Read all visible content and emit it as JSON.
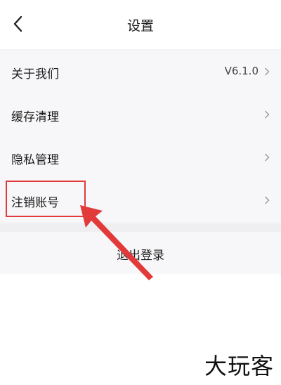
{
  "header": {
    "title": "设置",
    "back_icon": "chevron-left-icon"
  },
  "settings": {
    "items": [
      {
        "label": "关于我们",
        "value": "V6.1.0"
      },
      {
        "label": "缓存清理",
        "value": ""
      },
      {
        "label": "隐私管理",
        "value": ""
      },
      {
        "label": "注销账号",
        "value": ""
      }
    ],
    "chevron_icon": "chevron-right-icon"
  },
  "logout": {
    "label": "退出登录"
  },
  "annotation": {
    "color": "#e23a3a"
  },
  "watermark": {
    "text": "大玩客"
  }
}
